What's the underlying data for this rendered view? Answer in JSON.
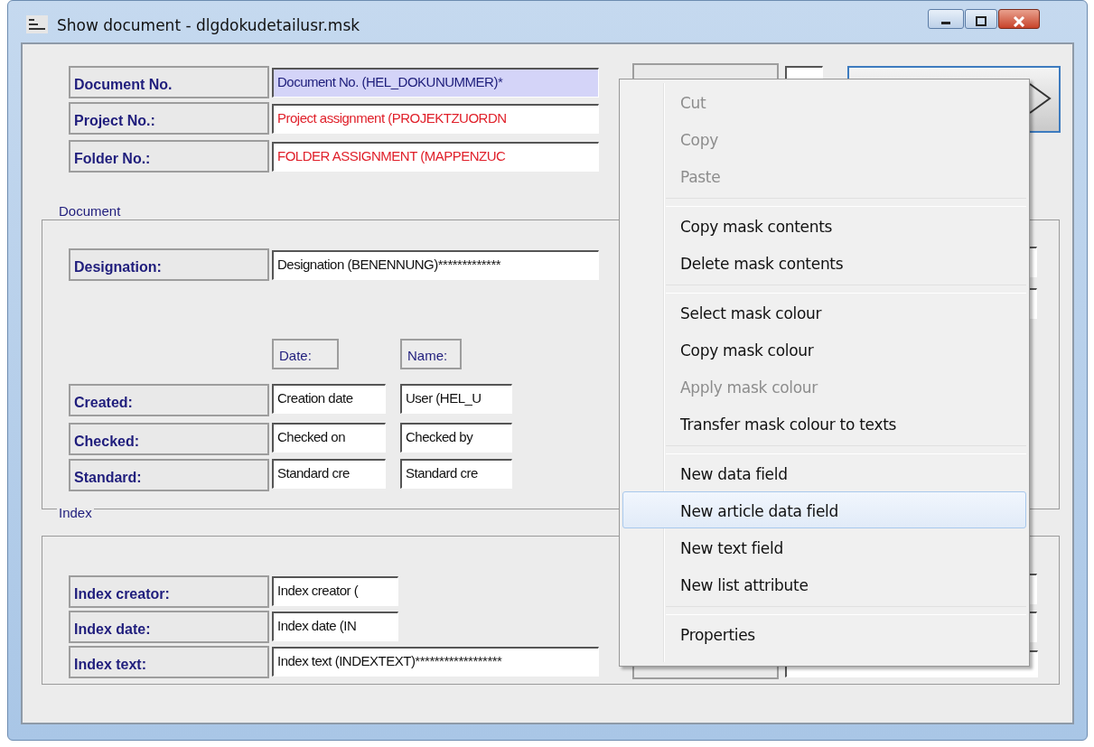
{
  "window": {
    "title": "Show document - dlgdokudetailusr.msk"
  },
  "header_fields": [
    {
      "label": "Document No.",
      "value": "Document No. (HEL_DOKUNUMMER)*",
      "color": "#1c1c7a",
      "highlighted": true
    },
    {
      "label": "Project No.:",
      "value": "Project assignment (PROJEKTZUORDN",
      "color": "#e0202a",
      "highlighted": false
    },
    {
      "label": "Folder No.:",
      "value": "FOLDER ASSIGNMENT (MAPPENZUC",
      "color": "#e0202a",
      "highlighted": false
    }
  ],
  "document_group": {
    "title": "Document",
    "designation": {
      "label": "Designation:",
      "value": "Designation (BENENNUNG)*************"
    },
    "column_headers": [
      "Date:",
      "Name:"
    ],
    "rows": [
      {
        "label": "Created:",
        "date": "Creation date",
        "name": "User (HEL_U"
      },
      {
        "label": "Checked:",
        "date": "Checked on",
        "name": "Checked by"
      },
      {
        "label": "Standard:",
        "date": "Standard cre",
        "name": "Standard cre"
      }
    ]
  },
  "index_group": {
    "title": "Index",
    "rows": [
      {
        "label": "Index creator:",
        "value": "Index creator (",
        "wide": false
      },
      {
        "label": "Index date:",
        "value": "Index date (IN",
        "wide": false
      },
      {
        "label": "Index text:",
        "value": "Index text (INDEXTEXT)******************",
        "wide": true
      }
    ]
  },
  "context_menu": [
    {
      "kind": "item",
      "label": "Cut",
      "disabled": true,
      "selected": false
    },
    {
      "kind": "item",
      "label": "Copy",
      "disabled": true,
      "selected": false
    },
    {
      "kind": "item",
      "label": "Paste",
      "disabled": true,
      "selected": false
    },
    {
      "kind": "separator"
    },
    {
      "kind": "item",
      "label": "Copy mask contents",
      "disabled": false,
      "selected": false
    },
    {
      "kind": "item",
      "label": "Delete mask contents",
      "disabled": false,
      "selected": false
    },
    {
      "kind": "separator"
    },
    {
      "kind": "item",
      "label": "Select mask colour",
      "disabled": false,
      "selected": false
    },
    {
      "kind": "item",
      "label": "Copy mask colour",
      "disabled": false,
      "selected": false
    },
    {
      "kind": "item",
      "label": "Apply mask colour",
      "disabled": true,
      "selected": false
    },
    {
      "kind": "item",
      "label": "Transfer mask colour to texts",
      "disabled": false,
      "selected": false
    },
    {
      "kind": "separator"
    },
    {
      "kind": "item",
      "label": "New data field",
      "disabled": false,
      "selected": false
    },
    {
      "kind": "item",
      "label": "New article data field",
      "disabled": false,
      "selected": true
    },
    {
      "kind": "item",
      "label": "New text field",
      "disabled": false,
      "selected": false
    },
    {
      "kind": "item",
      "label": "New list attribute",
      "disabled": false,
      "selected": false
    },
    {
      "kind": "separator"
    },
    {
      "kind": "item",
      "label": "Properties",
      "disabled": false,
      "selected": false
    }
  ]
}
